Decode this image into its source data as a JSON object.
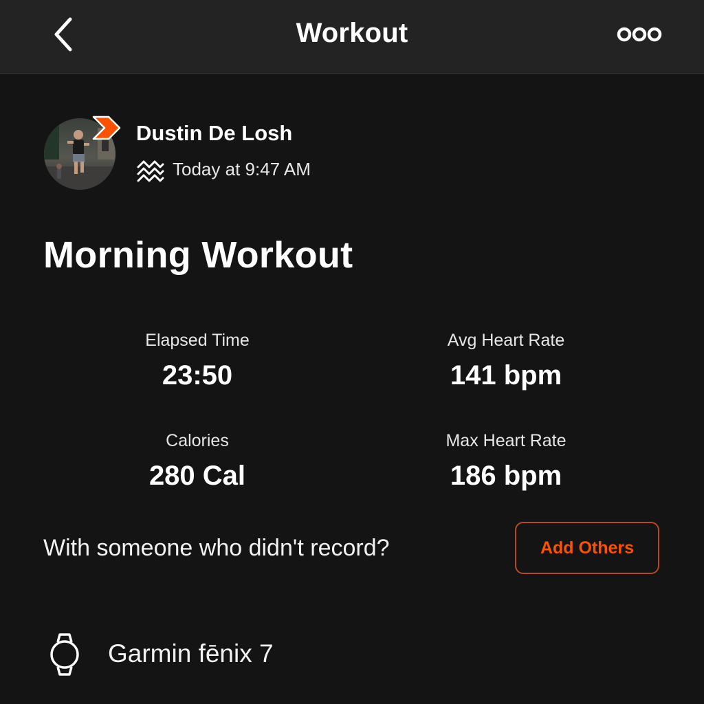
{
  "navbar": {
    "title": "Workout",
    "back_icon": "chevron-left-icon",
    "more_icon": "more-options-icon"
  },
  "athlete": {
    "name": "Dustin De Losh",
    "activity_time": "Today at 9:47 AM",
    "activity_icon": "workout-type-icon",
    "badge_icon": "subscriber-badge-icon"
  },
  "workout": {
    "title": "Morning Workout"
  },
  "stats": [
    {
      "label": "Elapsed Time",
      "value": "23:50"
    },
    {
      "label": "Avg Heart Rate",
      "value": "141 bpm"
    },
    {
      "label": "Calories",
      "value": "280 Cal"
    },
    {
      "label": "Max Heart Rate",
      "value": "186 bpm"
    }
  ],
  "group": {
    "prompt": "With someone who didn't record?",
    "add_button_label": "Add Others"
  },
  "device": {
    "icon": "watch-icon",
    "name": "Garmin fēnix 7"
  },
  "colors": {
    "background": "#141414",
    "navbar": "#232323",
    "accent": "#fc5200",
    "text": "#ffffff"
  }
}
